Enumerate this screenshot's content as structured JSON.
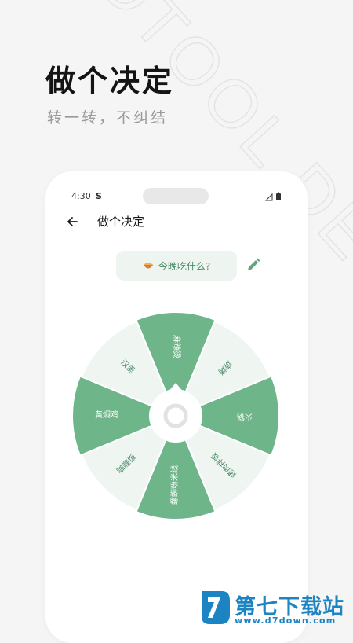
{
  "watermark": "DTOOL DECISION",
  "headline": "做个决定",
  "subline": "转一转，不纠结",
  "phone": {
    "status": {
      "time": "4:30",
      "carrier_icon": "S"
    },
    "screen_title": "做个决定",
    "question": {
      "icon": "bowl-icon",
      "text": "今晚吃什么?"
    },
    "wheel": {
      "options": [
        "麻辣烫",
        "烧烤",
        "火锅",
        "烤肉拌饭",
        "螺蛳粉米线",
        "咖喱饭",
        "黄焖鸡",
        "汉堡"
      ],
      "highlighted": [
        true,
        false,
        true,
        false,
        true,
        false,
        true,
        false
      ]
    }
  },
  "colors": {
    "accent": "#6fb58a",
    "accent_light": "#eff5f1",
    "accent_text": "#4a8a66",
    "logo": "#1d84c4"
  },
  "brand": {
    "name": "第七下载站",
    "url": "www.d7down.com"
  }
}
